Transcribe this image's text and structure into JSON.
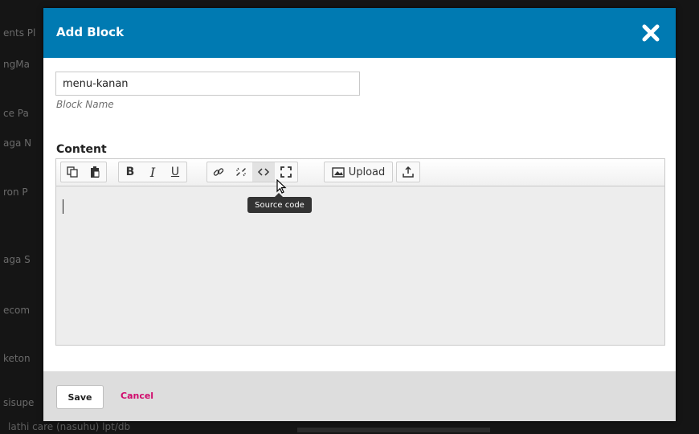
{
  "background": {
    "labels": [
      "ents Pl",
      "ngMa",
      "ce Pa",
      "aga N",
      "ron P",
      "aga S",
      "ecom",
      "keton",
      "sisupe"
    ],
    "footer_text": "lathi care (nasuhu) lpt/db"
  },
  "modal": {
    "title": "Add Block",
    "close_icon": "close-icon",
    "block_name": {
      "value": "menu-kanan",
      "hint": "Block Name"
    },
    "content_label": "Content",
    "toolbar": {
      "upload_label": "Upload",
      "tooltip": "Source code",
      "buttons": [
        "copy",
        "paste",
        "bold",
        "italic",
        "underline",
        "link",
        "unlink",
        "source-code",
        "fullscreen",
        "upload",
        "download"
      ]
    },
    "footer": {
      "save_label": "Save",
      "cancel_label": "Cancel"
    }
  },
  "colors": {
    "header": "#007ab2",
    "cancel": "#d00a6c",
    "footer_bg": "#dddddd"
  }
}
